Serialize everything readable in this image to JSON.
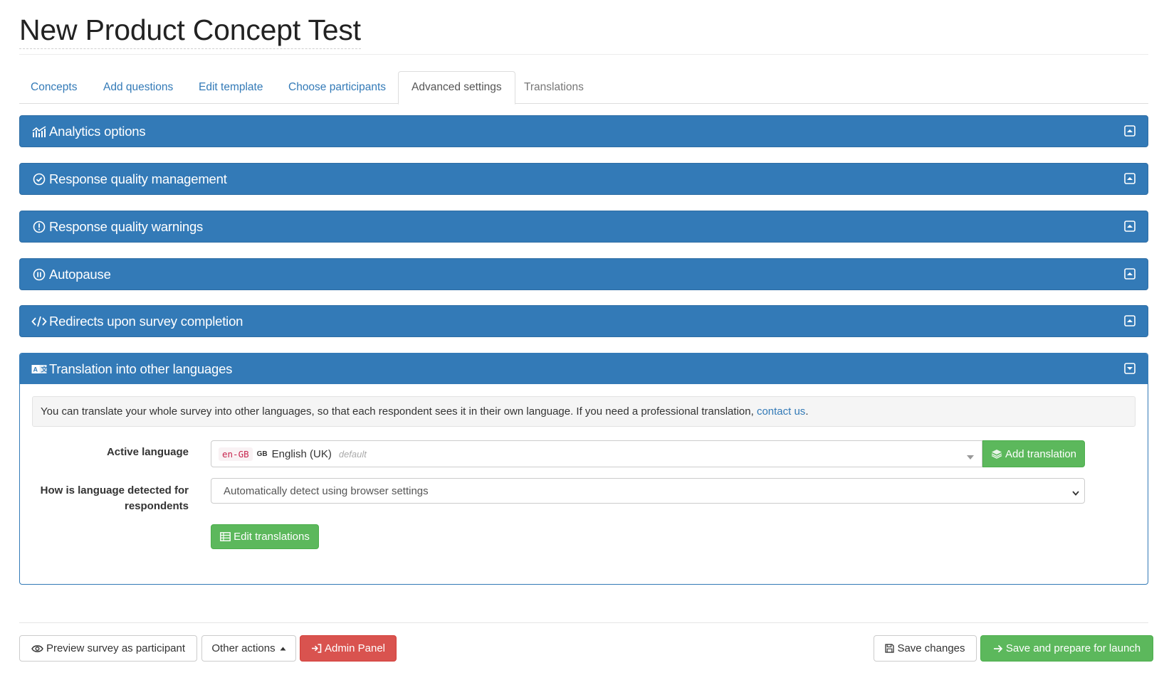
{
  "page": {
    "title": "New Product Concept Test"
  },
  "tabs": [
    {
      "label": "Concepts"
    },
    {
      "label": "Add questions"
    },
    {
      "label": "Edit template"
    },
    {
      "label": "Choose participants"
    },
    {
      "label": "Advanced settings",
      "active": true
    },
    {
      "label": "Translations"
    }
  ],
  "panels": [
    {
      "title": "Analytics options",
      "icon": "chart-icon",
      "state": "collapsed"
    },
    {
      "title": "Response quality management",
      "icon": "check-circle-icon",
      "state": "collapsed"
    },
    {
      "title": "Response quality warnings",
      "icon": "exclamation-circle-icon",
      "state": "collapsed"
    },
    {
      "title": "Autopause",
      "icon": "pause-circle-icon",
      "state": "collapsed"
    },
    {
      "title": "Redirects upon survey completion",
      "icon": "code-icon",
      "state": "collapsed"
    },
    {
      "title": "Translation into other languages",
      "icon": "translate-icon",
      "state": "expanded"
    }
  ],
  "translation": {
    "info_text": "You can translate your whole survey into other languages, so that each respondent sees it in their own language. If you need a professional translation,",
    "info_link": "contact us",
    "info_suffix": ".",
    "active_language_label": "Active language",
    "active_language": {
      "code": "en-GB",
      "flag": "GB",
      "name": "English (UK)",
      "tag": "default"
    },
    "add_translation_label": "Add translation",
    "detection_label": "How is language detected for respondents",
    "detection_value": "Automatically detect using browser settings",
    "edit_translations_label": "Edit translations"
  },
  "footer": {
    "preview_label": "Preview survey as participant",
    "other_actions_label": "Other actions",
    "admin_panel_label": "Admin Panel",
    "save_changes_label": "Save changes",
    "save_launch_label": "Save and prepare for launch"
  },
  "colors": {
    "primary": "#337ab7",
    "success": "#5cb85c",
    "danger": "#d9534f",
    "link": "#337ab7"
  }
}
